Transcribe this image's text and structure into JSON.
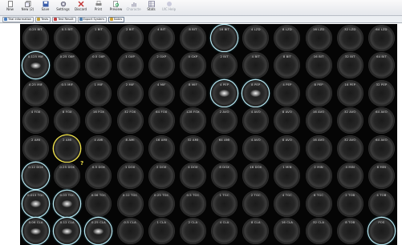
{
  "toolbar": {
    "buttons": [
      {
        "label": "New",
        "icon": "new-icon",
        "disabled": false
      },
      {
        "label": "New (2)",
        "icon": "new-copy-icon",
        "disabled": false
      },
      {
        "label": "Save",
        "icon": "save-icon",
        "disabled": false
      },
      {
        "label": "Settings",
        "icon": "gear-icon",
        "disabled": false
      },
      {
        "label": "Discard",
        "icon": "discard-icon",
        "disabled": false
      },
      {
        "label": "Print",
        "icon": "print-icon",
        "disabled": false
      },
      {
        "label": "Preview",
        "icon": "preview-icon",
        "disabled": false
      },
      {
        "label": "Characte",
        "icon": "chart-icon",
        "disabled": true
      },
      {
        "label": "Stats",
        "icon": "table-icon",
        "disabled": false
      },
      {
        "label": "UIC Help",
        "icon": "help-icon",
        "disabled": true
      }
    ]
  },
  "tabs": [
    {
      "label": "Trial Information",
      "icon": "info-icon",
      "color": "#4a7fc0",
      "active": false
    },
    {
      "label": "Tests",
      "icon": "tests-icon",
      "color": "#c0a040",
      "active": false
    },
    {
      "label": "Test Result",
      "icon": "result-icon",
      "color": "#c04040",
      "active": false
    },
    {
      "label": "Export System",
      "icon": "export-icon",
      "color": "#5080b0",
      "active": false
    },
    {
      "label": "Notes",
      "icon": "notes-icon",
      "color": "#d0a030",
      "active": true
    }
  ],
  "plate": {
    "rows": [
      [
        "0.25 BIT",
        "0.5 BIT",
        "1 BIT",
        "2 BIT",
        "4 BIT",
        "8 BIT",
        "16 BIT",
        "4 LZD",
        "8 LZD",
        "16 LZD",
        "32 LZD",
        "64 LZD"
      ],
      [
        "0.125 MIF",
        "0.25 OXP",
        "0.5 OXP",
        "1 OXP",
        "2 OXP",
        "4 OXP",
        "2 BIT",
        "4 BIT",
        "8 BIT",
        "16 BIT",
        "32 BIT",
        "64 BIT"
      ],
      [
        "0.25 MIF",
        "0.5 MIF",
        "1 MIF",
        "2 MIF",
        "4 MIF",
        "8 MIF",
        "4 PEP",
        "8 PEP",
        "4 PEP",
        "8 PEP",
        "16 PEP",
        "32 PEP"
      ],
      [
        "4 FOX",
        "8 FOX",
        "16 FOX",
        "32 FOX",
        "64 FOX",
        "128 FOX",
        "2 AVO",
        "4 AVO",
        "8 AVO",
        "16 AVO",
        "32 AVO",
        "64 AVO"
      ],
      [
        "2 AMI",
        "2 AMI",
        "4 AMI",
        "8 AMI",
        "16 AMI",
        "32 AMI",
        "64 AMI",
        "4 AVO",
        "8 AVO",
        "16 AVO",
        "32 AVO",
        "64 AVO"
      ],
      [
        "0.12 DOX",
        "0.25 DOX",
        "0.5 DOX",
        "1 DOX",
        "2 DOX",
        "4 DOX",
        "8 DOX",
        "16 DOX",
        "1 MIN",
        "2 MIN",
        "4 MIN",
        "8 MIN"
      ],
      [
        "0.015 TGC",
        "0.03 TGC",
        "0.06 TGC",
        "0.12 TGC",
        "0.25 TGC",
        "0.5 TGC",
        "1 TGC",
        "2 TGC",
        "4 TGC",
        "8 TGC",
        "2 TOB",
        "4 TOB"
      ],
      [
        "0.06 CLA",
        "0.12 CLA",
        "0.25 CLA",
        "0.5 CLA",
        "1 CLA",
        "2 CLA",
        "4 CLA",
        "8 CLA",
        "16 CLA",
        "32 CLA",
        "8 TOB",
        "POS"
      ]
    ],
    "hit_wells": [
      "0-6",
      "1-0",
      "2-6",
      "2-7",
      "5-0",
      "6-0",
      "6-1",
      "7-0",
      "7-1",
      "7-2",
      "7-11"
    ],
    "growth_wells": [
      "1-0",
      "2-6",
      "2-7",
      "6-0",
      "6-1",
      "7-0",
      "7-1",
      "7-2"
    ],
    "flag_wells": [
      "4-1"
    ],
    "flag_mark": "?"
  }
}
